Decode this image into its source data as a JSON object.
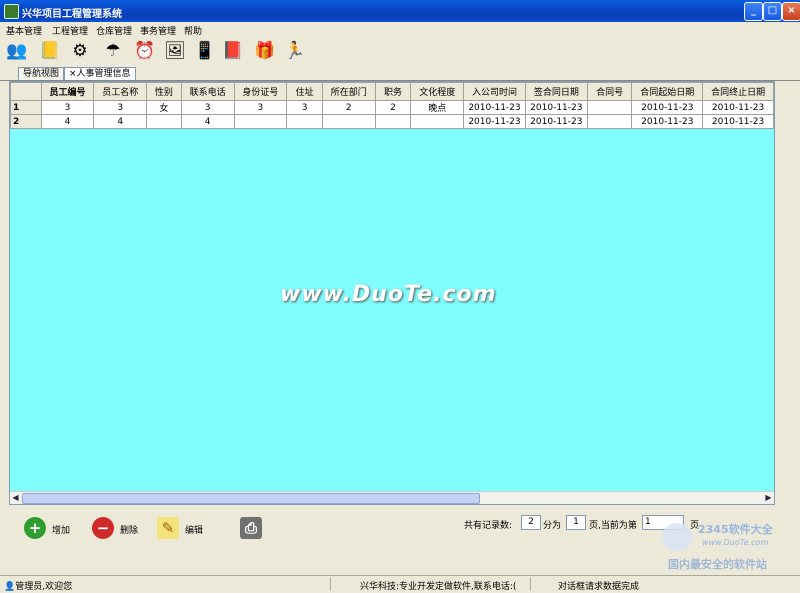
{
  "window": {
    "title": "兴华项目工程管理系统"
  },
  "menu": [
    "基本管理",
    "工程管理",
    "仓库管理",
    "事务管理",
    "帮助"
  ],
  "toolbar_icons": [
    "users-icon",
    "book-icon",
    "gears-icon",
    "umbrella-icon",
    "alarm-clock-icon",
    "picture-icon",
    "pda-icon",
    "help-book-icon",
    "gift-icon",
    "running-man-icon"
  ],
  "tabs": [
    "导航视图",
    "×人事管理信息"
  ],
  "table": {
    "columns": [
      "员工编号",
      "员工名称",
      "性别",
      "联系电话",
      "身份证号",
      "住址",
      "所在部门",
      "职务",
      "文化程度",
      "入公司时间",
      "签合同日期",
      "合同号",
      "合同起始日期",
      "合同终止日期"
    ],
    "rows": [
      {
        "num": "1",
        "cells": [
          "3",
          "3",
          "女",
          "3",
          "3",
          "3",
          "2",
          "2",
          "晚点",
          "2010-11-23",
          "2010-11-23",
          "",
          "2010-11-23",
          "2010-11-23"
        ]
      },
      {
        "num": "2",
        "cells": [
          "4",
          "4",
          "",
          "4",
          "",
          "",
          "",
          "",
          "",
          "2010-11-23",
          "2010-11-23",
          "",
          "2010-11-23",
          "2010-11-23"
        ]
      }
    ]
  },
  "watermark": "www.DuoTe.com",
  "actions": {
    "add": "增加",
    "delete": "删除",
    "edit": "编辑"
  },
  "pager": {
    "total_label": "共有记录数:",
    "total": "2",
    "split_label": "分为",
    "pages": "1",
    "current_label": "页,当前为第",
    "current": "1",
    "suffix": "页"
  },
  "status": {
    "user": "管理员,欢迎您",
    "company": "兴华科技:专业开发定做软件,联系电话:(",
    "message": "对话框请求数据完成"
  },
  "corner_watermark": {
    "brand": "2345软件大全",
    "url": "www.DuoTe.com",
    "slogan": "国内最安全的软件站"
  }
}
